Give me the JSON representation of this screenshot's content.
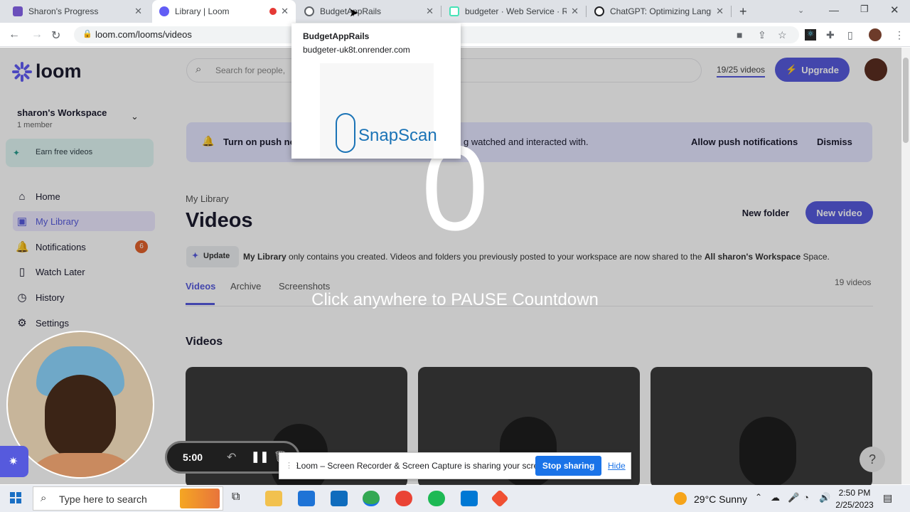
{
  "browser": {
    "tabs": [
      {
        "title": "Sharon's Progress",
        "color": "#6b4fbb"
      },
      {
        "title": "Library | Loom",
        "color": "#625df5"
      },
      {
        "title": "BudgetAppRails",
        "color": "#5f6368"
      },
      {
        "title": "budgeter · Web Service · Re",
        "color": "#46e3b7"
      },
      {
        "title": "ChatGPT: Optimizing Langua",
        "color": "#202124"
      }
    ],
    "url": "loom.com/looms/videos",
    "hover_card": {
      "title": "BudgetAppRails",
      "url": "budgeter-uk8t.onrender.com",
      "preview_text": "SnapScan"
    }
  },
  "header": {
    "search_placeholder": "Search for people,",
    "video_quota": "19/25 videos",
    "upgrade_label": "Upgrade"
  },
  "sidebar": {
    "logo": "loom",
    "workspace_name": "sharon's Workspace",
    "workspace_members": "1 member",
    "earn_label": "Earn free videos",
    "items": [
      {
        "label": "Home",
        "icon": "home-icon"
      },
      {
        "label": "My Library",
        "icon": "library-icon"
      },
      {
        "label": "Notifications",
        "icon": "bell-icon",
        "badge": "6"
      },
      {
        "label": "Watch Later",
        "icon": "bookmark-icon"
      },
      {
        "label": "History",
        "icon": "history-icon"
      },
      {
        "label": "Settings",
        "icon": "gear-icon"
      }
    ]
  },
  "notice": {
    "text_start": "Turn on push no",
    "text_end": "g watched and interacted with.",
    "allow_label": "Allow push notifications",
    "dismiss_label": "Dismiss"
  },
  "library": {
    "breadcrumb": "My Library",
    "title": "Videos",
    "new_folder_label": "New folder",
    "new_video_label": "New video",
    "update_tag": "Update",
    "update_prefix": "My Library",
    "update_text": " only contains you created. Videos and folders you previously posted to your workspace are now shared to the ",
    "update_bold2": "All sharon's Workspace",
    "update_suffix": " Space.",
    "tabs": [
      "Videos",
      "Archive",
      "Screenshots"
    ],
    "count": "19 videos",
    "section_title": "Videos"
  },
  "countdown": {
    "number": "0",
    "message": "Click anywhere to PAUSE Countdown"
  },
  "recorder": {
    "timer": "5:00"
  },
  "share_bar": {
    "text": "Loom – Screen Recorder & Screen Capture is sharing your screen.",
    "stop_label": "Stop sharing",
    "hide_label": "Hide"
  },
  "taskbar": {
    "search_placeholder": "Type here to search",
    "weather": "29°C  Sunny",
    "time": "2:50 PM",
    "date": "2/25/2023"
  },
  "colors": {
    "accent": "#565add",
    "share_blue": "#1a73e8"
  }
}
